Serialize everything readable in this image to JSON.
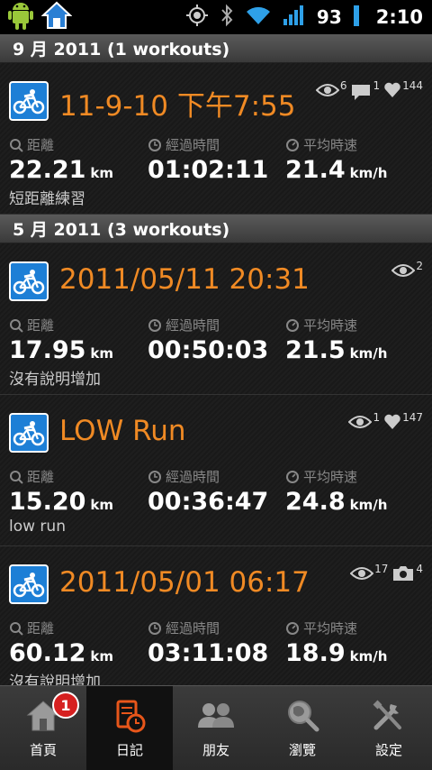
{
  "status_bar": {
    "battery": "93",
    "time": "2:10"
  },
  "sections": [
    {
      "header": "9 月 2011 (1 workouts)",
      "workouts": [
        {
          "title": "11-9-10 下午7:55",
          "badges": [
            {
              "icon": "eye-icon",
              "count": "6"
            },
            {
              "icon": "comment-icon",
              "count": "1"
            },
            {
              "icon": "heart-icon",
              "count": "144"
            }
          ],
          "distance": {
            "label": "距離",
            "value": "22.21",
            "unit": "km"
          },
          "duration": {
            "label": "經過時間",
            "value": "01:02:11"
          },
          "speed": {
            "label": "平均時速",
            "value": "21.4",
            "unit": "km/h"
          },
          "description": "短距離練習"
        }
      ]
    },
    {
      "header": "5 月 2011 (3 workouts)",
      "workouts": [
        {
          "title": "2011/05/11 20:31",
          "badges": [
            {
              "icon": "eye-icon",
              "count": "2"
            }
          ],
          "distance": {
            "label": "距離",
            "value": "17.95",
            "unit": "km"
          },
          "duration": {
            "label": "經過時間",
            "value": "00:50:03"
          },
          "speed": {
            "label": "平均時速",
            "value": "21.5",
            "unit": "km/h"
          },
          "description": "沒有說明增加"
        },
        {
          "title": "LOW Run",
          "badges": [
            {
              "icon": "eye-icon",
              "count": "1"
            },
            {
              "icon": "heart-icon",
              "count": "147"
            }
          ],
          "distance": {
            "label": "距離",
            "value": "15.20",
            "unit": "km"
          },
          "duration": {
            "label": "經過時間",
            "value": "00:36:47"
          },
          "speed": {
            "label": "平均時速",
            "value": "24.8",
            "unit": "km/h"
          },
          "description": "low run"
        },
        {
          "title": "2011/05/01 06:17",
          "badges": [
            {
              "icon": "eye-icon",
              "count": "17"
            },
            {
              "icon": "camera-icon",
              "count": "4"
            }
          ],
          "distance": {
            "label": "距離",
            "value": "60.12",
            "unit": "km"
          },
          "duration": {
            "label": "經過時間",
            "value": "03:11:08"
          },
          "speed": {
            "label": "平均時速",
            "value": "18.9",
            "unit": "km/h"
          },
          "description": "沒有說明增加"
        }
      ]
    }
  ],
  "tabs": [
    {
      "label": "首頁",
      "icon": "home-icon",
      "notification": "1",
      "active": false
    },
    {
      "label": "日記",
      "icon": "diary-icon",
      "active": true
    },
    {
      "label": "朋友",
      "icon": "friends-icon",
      "active": false
    },
    {
      "label": "瀏覽",
      "icon": "browse-icon",
      "active": false
    },
    {
      "label": "設定",
      "icon": "settings-icon",
      "active": false
    }
  ],
  "colors": {
    "accent": "#f08a24",
    "sport_icon_bg": "#1d7fd6",
    "notification": "#d62020"
  }
}
